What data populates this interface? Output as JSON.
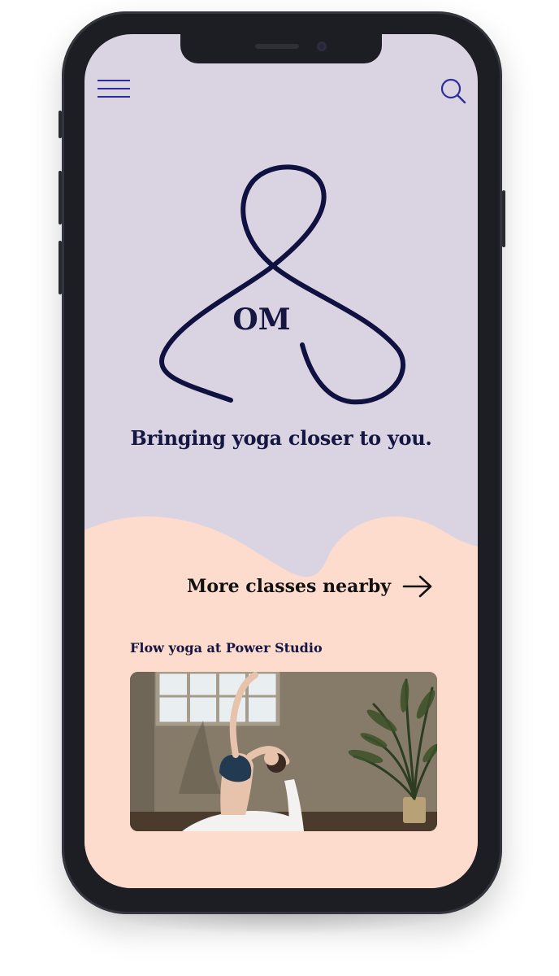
{
  "header": {
    "menu_icon": "hamburger-menu-icon",
    "search_icon": "search-icon"
  },
  "hero": {
    "logo_text": "OM",
    "tagline": "Bringing yoga closer to you."
  },
  "nearby": {
    "label": "More classes nearby",
    "icon": "arrow-right-icon"
  },
  "class_card": {
    "title": "Flow yoga at Power Studio"
  },
  "colors": {
    "top_background": "#dad3e2",
    "bottom_background": "#fddcce",
    "ink": "#151742",
    "accent_blue": "#2e2e9a"
  }
}
